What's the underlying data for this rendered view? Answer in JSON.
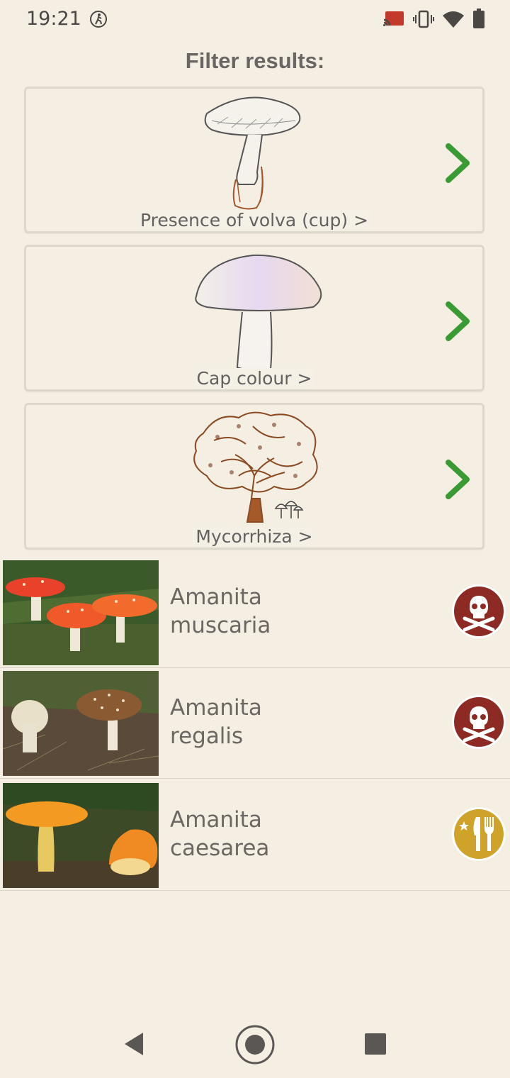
{
  "status_bar": {
    "time": "19:21",
    "icons": [
      "accessibility-icon",
      "cast-icon",
      "vibrate-icon",
      "wifi-icon",
      "battery-icon"
    ]
  },
  "heading": "Filter results:",
  "filters": [
    {
      "label": "Presence of volva (cup) >",
      "icon": "mushroom-volva-illustration"
    },
    {
      "label": "Cap colour >",
      "icon": "mushroom-cap-illustration"
    },
    {
      "label": "Mycorrhiza >",
      "icon": "tree-mycorrhiza-illustration"
    }
  ],
  "species": [
    {
      "genus": "Amanita",
      "epithet": "muscaria",
      "badge": "poisonous-skull-icon"
    },
    {
      "genus": "Amanita",
      "epithet": "regalis",
      "badge": "poisonous-skull-icon"
    },
    {
      "genus": "Amanita",
      "epithet": "caesarea",
      "badge": "edible-cutlery-star-icon"
    }
  ],
  "colors": {
    "background": "#f4eee3",
    "chevron": "#3a9a34",
    "poison_badge": "#8e2a24",
    "edible_badge": "#cfa22a"
  },
  "nav_bar": {
    "buttons": [
      "back-button",
      "home-button",
      "recents-button"
    ]
  }
}
